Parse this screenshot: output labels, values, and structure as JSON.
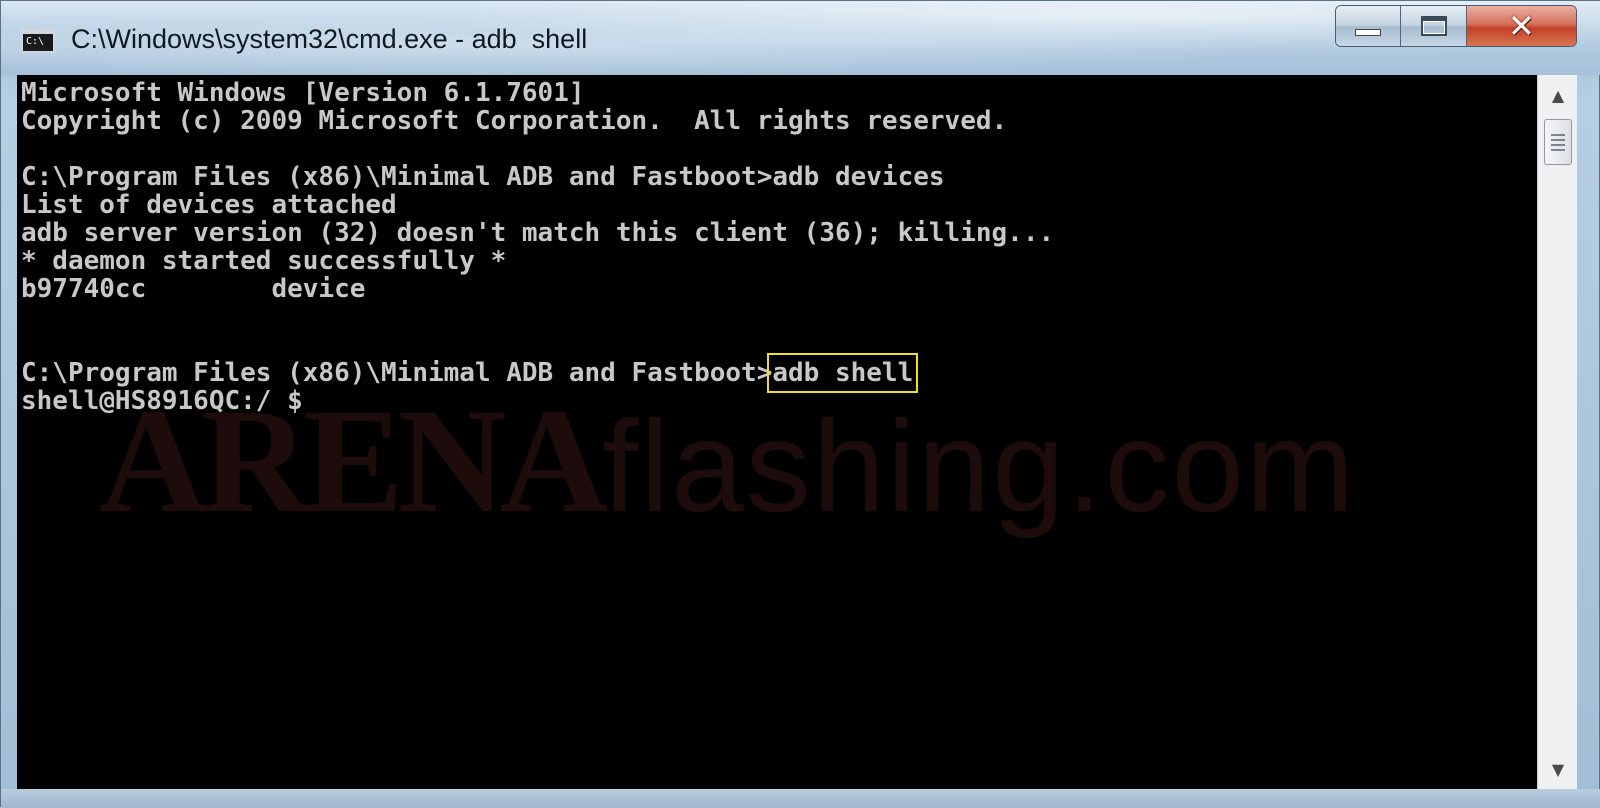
{
  "window": {
    "title": "C:\\Windows\\system32\\cmd.exe - adb  shell",
    "app_icon": {
      "name": "cmd-icon",
      "glyph": "C:\\"
    },
    "controls": {
      "minimize_icon": "minimize-icon",
      "maximize_icon": "maximize-icon",
      "close_icon": "close-icon",
      "close_glyph": "✕"
    }
  },
  "console": {
    "lines": [
      "Microsoft Windows [Version 6.1.7601]",
      "Copyright (c) 2009 Microsoft Corporation.  All rights reserved.",
      "",
      "C:\\Program Files (x86)\\Minimal ADB and Fastboot>adb devices",
      "List of devices attached",
      "adb server version (32) doesn't match this client (36); killing...",
      "* daemon started successfully *",
      "b97740cc        device",
      "",
      ""
    ],
    "prompt_line": {
      "prompt": "C:\\Program Files (x86)\\Minimal ADB and Fastboot>",
      "command": "adb shell"
    },
    "shell_line": "shell@HS8916QC:/ $",
    "highlight_color": "#f0e020",
    "text_color": "#c8c8c8",
    "background": "#000000"
  },
  "watermark": {
    "part1": "ARENA",
    "part2": "flashing.com"
  },
  "scrollbar": {
    "up_glyph": "▲",
    "down_glyph": "▼"
  }
}
